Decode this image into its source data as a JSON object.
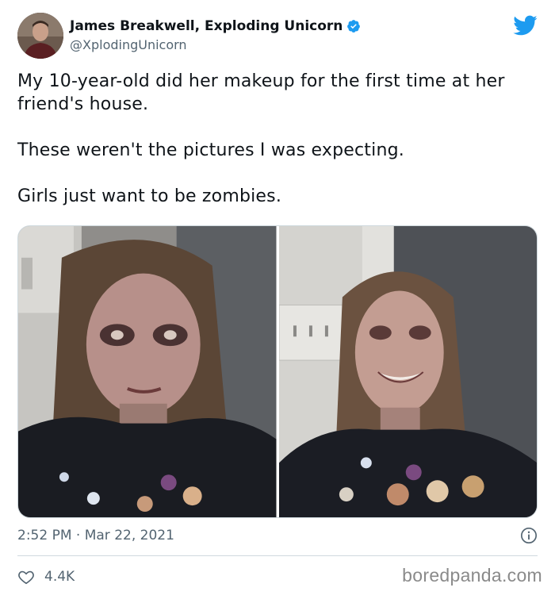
{
  "author": {
    "name": "James Breakwell, Exploding Unicorn",
    "handle": "@XplodingUnicorn",
    "verified": true
  },
  "tweet": {
    "paragraphs": [
      "My 10-year-old did her makeup for the first time at her friend's house.",
      "These weren't the pictures I was expecting.",
      "Girls just want to be zombies."
    ]
  },
  "meta": {
    "timestamp": "2:52 PM · Mar 22, 2021",
    "likes": "4.4K"
  },
  "watermark": "boredpanda.com",
  "icons": {
    "brand": "twitter-bird-icon",
    "verified": "verified-badge-icon",
    "info": "info-icon",
    "like": "heart-icon"
  },
  "colors": {
    "twitter_blue": "#1d9bf0",
    "text_primary": "#0f1419",
    "text_secondary": "#536471",
    "border": "#cfd9de"
  }
}
